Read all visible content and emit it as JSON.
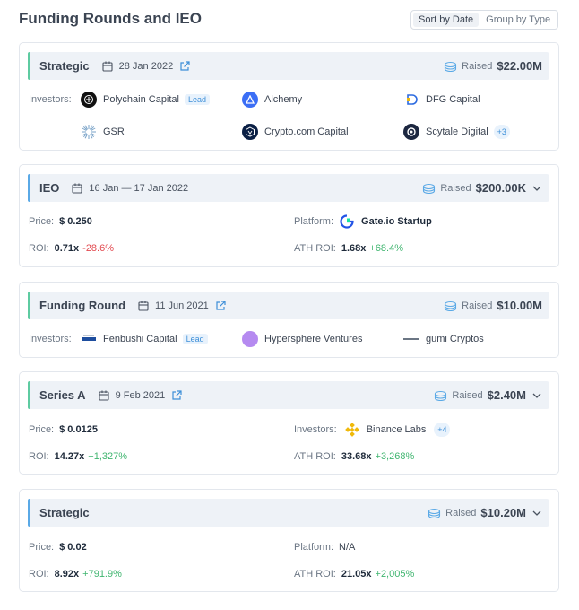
{
  "header": {
    "title": "Funding Rounds and IEO",
    "sort_by_date": "Sort by Date",
    "group_by_type": "Group by Type"
  },
  "labels": {
    "investors": "Investors:",
    "price": "Price:",
    "roi": "ROI:",
    "platform": "Platform:",
    "ath_roi": "ATH ROI:",
    "raised": "Raised",
    "lead": "Lead"
  },
  "rounds": [
    {
      "title": "Strategic",
      "date": "28 Jan 2022",
      "raised": "$22.00M",
      "investors": [
        {
          "name": "Polychain Capital",
          "lead": "Lead"
        },
        {
          "name": "Alchemy"
        },
        {
          "name": "DFG Capital"
        },
        {
          "name": "GSR"
        },
        {
          "name": "Crypto.com Capital"
        },
        {
          "name": "Scytale Digital",
          "more": "+3"
        }
      ]
    },
    {
      "title": "IEO",
      "date": "16 Jan — 17 Jan 2022",
      "raised": "$200.00K",
      "price": "$ 0.250",
      "roi": "0.71x",
      "roi_change": "-28.6%",
      "platform": "Gate.io Startup",
      "ath_roi": "1.68x",
      "ath_roi_change": "+68.4%"
    },
    {
      "title": "Funding Round",
      "date": "11 Jun 2021",
      "raised": "$10.00M",
      "investors": [
        {
          "name": "Fenbushi Capital",
          "lead": "Lead"
        },
        {
          "name": "Hypersphere Ventures"
        },
        {
          "name": "gumi Cryptos"
        }
      ]
    },
    {
      "title": "Series A",
      "date": "9 Feb 2021",
      "raised": "$2.40M",
      "price": "$ 0.0125",
      "roi": "14.27x",
      "roi_change": "+1,327%",
      "investor": "Binance Labs",
      "investor_more": "+4",
      "ath_roi": "33.68x",
      "ath_roi_change": "+3,268%"
    },
    {
      "title": "Strategic",
      "raised": "$10.20M",
      "price": "$ 0.02",
      "roi": "8.92x",
      "roi_change": "+791.9%",
      "platform": "N/A",
      "ath_roi": "21.05x",
      "ath_roi_change": "+2,005%"
    }
  ],
  "colors": {
    "green_bar": "#5ecba1",
    "blue_bar": "#5aa9e6",
    "negative": "#e2494f",
    "positive": "#3fb56f",
    "link": "#3d8fd8"
  }
}
